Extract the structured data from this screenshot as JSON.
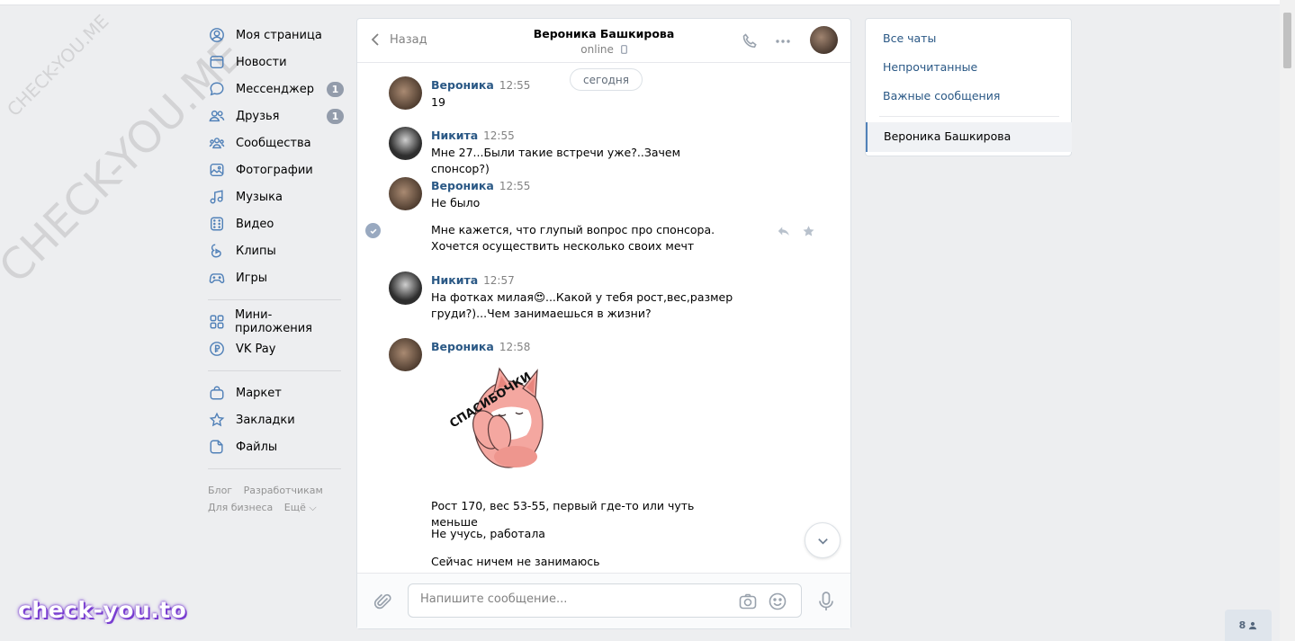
{
  "watermark": {
    "small": "CHECK-YOU.ME",
    "large": "CHECK-YOU.ME",
    "brand": "check-you.to"
  },
  "nav": {
    "items": [
      {
        "label": "Моя страница",
        "icon": "user-circle-icon"
      },
      {
        "label": "Новости",
        "icon": "news-icon"
      },
      {
        "label": "Мессенджер",
        "icon": "message-icon",
        "badge": "1"
      },
      {
        "label": "Друзья",
        "icon": "friends-icon",
        "badge": "1"
      },
      {
        "label": "Сообщества",
        "icon": "communities-icon"
      },
      {
        "label": "Фотографии",
        "icon": "photo-icon"
      },
      {
        "label": "Музыка",
        "icon": "music-icon"
      },
      {
        "label": "Видео",
        "icon": "video-icon"
      },
      {
        "label": "Клипы",
        "icon": "clips-icon"
      },
      {
        "label": "Игры",
        "icon": "gamepad-icon"
      }
    ],
    "items2": [
      {
        "label": "Мини-приложения",
        "icon": "apps-icon"
      },
      {
        "label": "VK Pay",
        "icon": "vkpay-icon"
      }
    ],
    "items3": [
      {
        "label": "Маркет",
        "icon": "market-icon"
      },
      {
        "label": "Закладки",
        "icon": "bookmark-icon"
      },
      {
        "label": "Файлы",
        "icon": "file-icon"
      }
    ],
    "footer": {
      "blog": "Блог",
      "dev": "Разработчикам",
      "business": "Для бизнеса",
      "more": "Ещё ⌵"
    }
  },
  "chat": {
    "back_label": "Назад",
    "peer_name": "Вероника Башкирова",
    "peer_status": "online",
    "date_label": "сегодня",
    "messages": [
      {
        "author": "Вероника",
        "time": "12:55",
        "text": "19"
      },
      {
        "author": "Никита",
        "time": "12:55",
        "text": "Мне 27...Были такие встречи уже?..Зачем спонсор?)"
      },
      {
        "author": "Вероника",
        "time": "12:55",
        "text": "Не было"
      },
      {
        "text": "Мне кажется, что глупый вопрос про спонсора. Хочется осуществить несколько своих мечт"
      },
      {
        "author": "Никита",
        "time": "12:57",
        "text": "На фотках милая😍...Какой у тебя рост,вес,размер груди?)...Чем занимаешься в жизни?"
      },
      {
        "author": "Вероника",
        "time": "12:58",
        "sticker_text": "СПАСИБОЧКИ"
      },
      {
        "text": "Рост 170, вес 53-55, первый где-то или чуть меньше"
      },
      {
        "text": "Не учусь, работала"
      },
      {
        "text": "Сейчас ничем не занимаюсь"
      }
    ],
    "composer_placeholder": "Напишите сообщение..."
  },
  "right_panel": {
    "all_chats": "Все чаты",
    "unread": "Непрочитанные",
    "important": "Важные сообщения",
    "active_chat": "Вероника Башкирова"
  },
  "online_count": "8"
}
